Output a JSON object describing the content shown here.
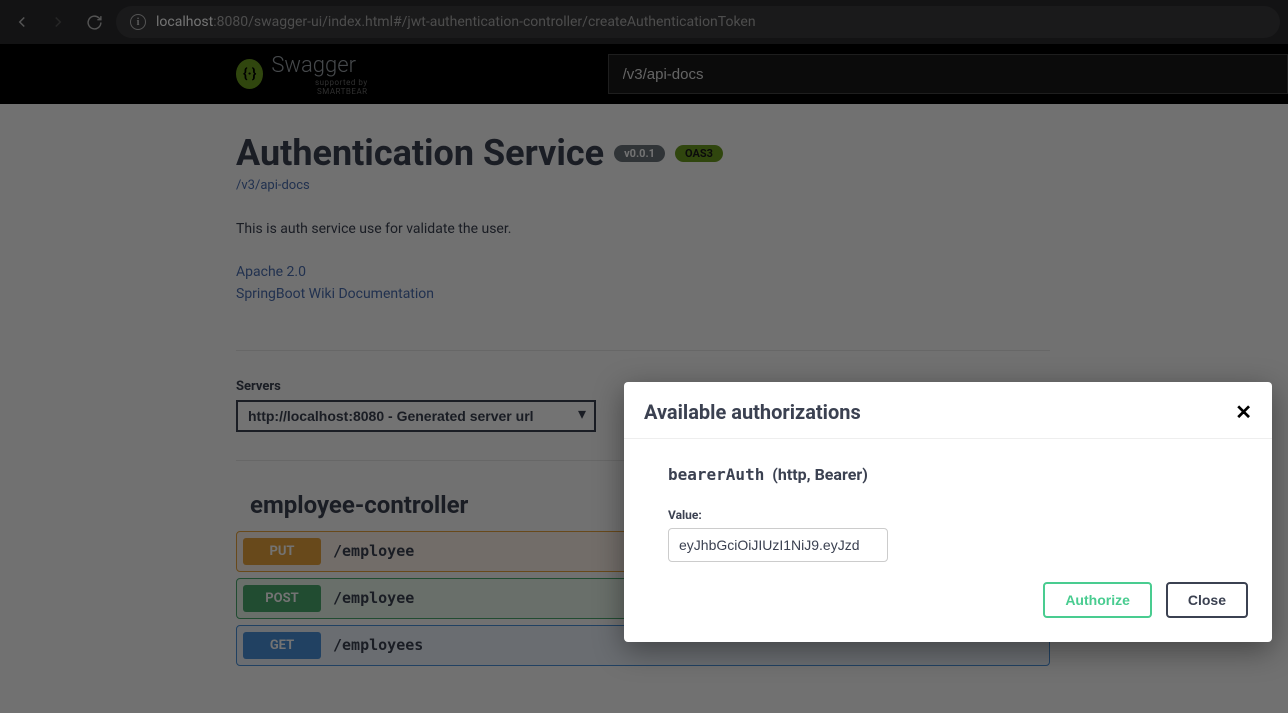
{
  "browser": {
    "url_host": "localhost",
    "url_port": ":8080",
    "url_path": "/swagger-ui/index.html#/jwt-authentication-controller/createAuthenticationToken"
  },
  "swagger": {
    "brand": "Swagger",
    "brand_sub": "supported by SMARTBEAR",
    "docs_input": "/v3/api-docs"
  },
  "api": {
    "title": "Authentication Service",
    "version": "v0.0.1",
    "oas_badge": "OAS3",
    "docs_link": "/v3/api-docs",
    "description": "This is auth service use for validate the user.",
    "links": [
      {
        "label": "Apache 2.0"
      },
      {
        "label": "SpringBoot Wiki Documentation"
      }
    ]
  },
  "servers": {
    "label": "Servers",
    "selected": "http://localhost:8080 - Generated server url"
  },
  "tag": {
    "name": "employee-controller"
  },
  "operations": [
    {
      "method": "PUT",
      "path": "/employee"
    },
    {
      "method": "POST",
      "path": "/employee"
    },
    {
      "method": "GET",
      "path": "/employees"
    }
  ],
  "modal": {
    "title": "Available authorizations",
    "scheme_name": "bearerAuth",
    "scheme_detail": "(http, Bearer)",
    "value_label": "Value:",
    "value": "eyJhbGciOiJIUzI1NiJ9.eyJzd",
    "authorize_btn": "Authorize",
    "close_btn": "Close"
  }
}
